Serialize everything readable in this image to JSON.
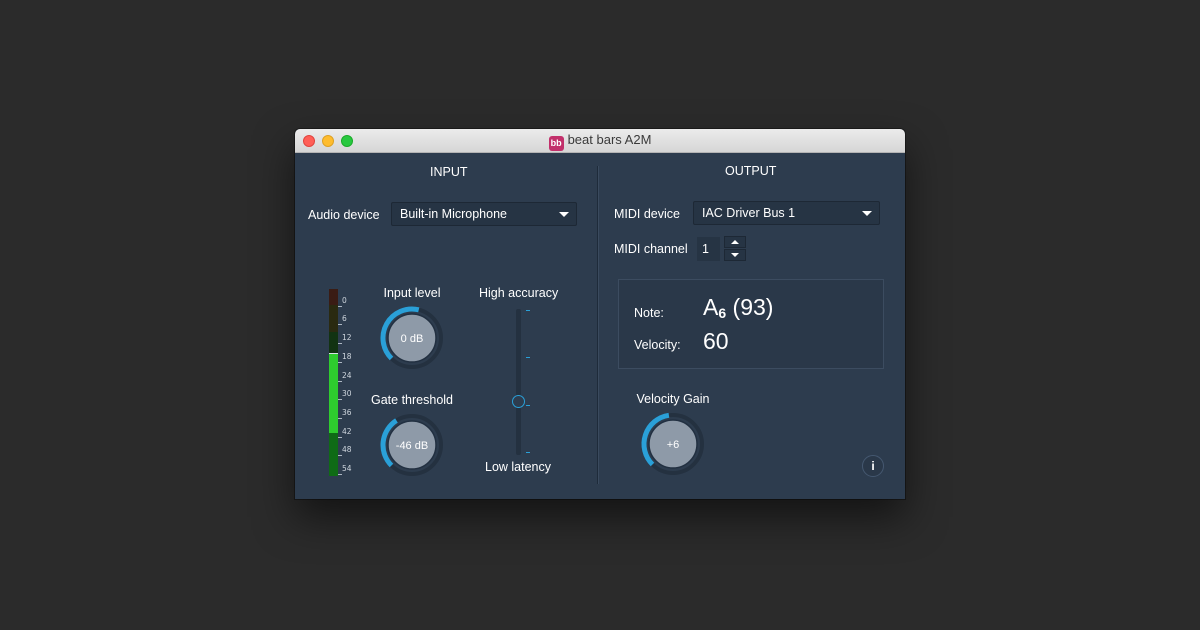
{
  "window": {
    "title": "beat bars A2M",
    "app_icon": "bb"
  },
  "input": {
    "heading": "INPUT",
    "audio_device_label": "Audio device",
    "audio_device_value": "Built-in Microphone",
    "meter_scale": [
      "0",
      "6",
      "12",
      "18",
      "24",
      "30",
      "36",
      "42",
      "48",
      "54"
    ],
    "meter_level_fraction": 0.63,
    "input_level": {
      "label": "Input level",
      "value": "0 dB",
      "fraction": 0.55
    },
    "gate_threshold": {
      "label": "Gate threshold",
      "value": "-46 dB",
      "fraction": 0.38
    },
    "latency_slider": {
      "top_label": "High accuracy",
      "bottom_label": "Low latency",
      "fraction_from_top": 0.66
    }
  },
  "output": {
    "heading": "OUTPUT",
    "midi_device_label": "MIDI device",
    "midi_device_value": "IAC Driver Bus 1",
    "midi_channel_label": "MIDI channel",
    "midi_channel_value": "1",
    "note_label": "Note:",
    "note_name": "A",
    "note_octave": "6",
    "note_number": "(93)",
    "velocity_label": "Velocity:",
    "velocity_value": "60",
    "velocity_gain": {
      "label": "Velocity Gain",
      "value": "+6",
      "fraction": 0.47
    },
    "info_label": "i"
  },
  "colors": {
    "panel_bg": "#2d3c4e",
    "accent": "#2aa0d8",
    "knob_face": "#8e9aa8",
    "meter_green": "#2ecc2e",
    "meter_dark_green": "#0f6b16"
  }
}
